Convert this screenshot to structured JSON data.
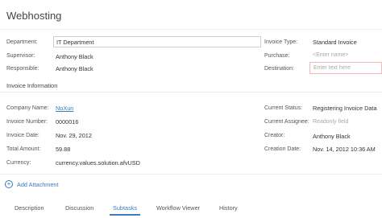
{
  "header": {
    "title": "Webhosting"
  },
  "form": {
    "department": {
      "label": "Department:",
      "value": "IT Department"
    },
    "supervisor": {
      "label": "Supervisor:",
      "value": "Anthony Black"
    },
    "responsible": {
      "label": "Responsible:",
      "value": "Anthony Black"
    },
    "invoice_type": {
      "label": "Invoice Type:",
      "value": "Standard Invoice"
    },
    "purchase": {
      "label": "Purchase:",
      "placeholder": "<Enter name>"
    },
    "destination": {
      "label": "Destination:",
      "placeholder": "Enter text here"
    }
  },
  "invoice_info": {
    "title": "Invoice Information",
    "company_name": {
      "label": "Company Name:",
      "value": "NoXun"
    },
    "invoice_number": {
      "label": "Invoice Number:",
      "value": "0000016"
    },
    "invoice_date": {
      "label": "Invoice Date:",
      "value": "Nov. 29, 2012"
    },
    "total_amount": {
      "label": "Total Amount:",
      "value": "59.88"
    },
    "currency": {
      "label": "Currency:",
      "value": "currency.values.solution.afvUSD"
    },
    "current_status": {
      "label": "Current Status:",
      "value": "Registering Invoice Data"
    },
    "current_assignee": {
      "label": "Current Assignee:",
      "value": "Readonly field"
    },
    "creator": {
      "label": "Creator:",
      "value": "Anthony Black"
    },
    "creation_date": {
      "label": "Creation Date:",
      "value": "Nov. 14, 2012 10:36 AM"
    }
  },
  "attachments": {
    "add_label": "Add Attachment",
    "icon": "plus-circle-icon"
  },
  "tabs": [
    {
      "label": "Description"
    },
    {
      "label": "Discussion"
    },
    {
      "label": "Subtasks",
      "active": true
    },
    {
      "label": "Workflow Viewer"
    },
    {
      "label": "History"
    }
  ],
  "colors": {
    "accent": "#3b7bbf",
    "error_border": "#f0b8b8"
  }
}
